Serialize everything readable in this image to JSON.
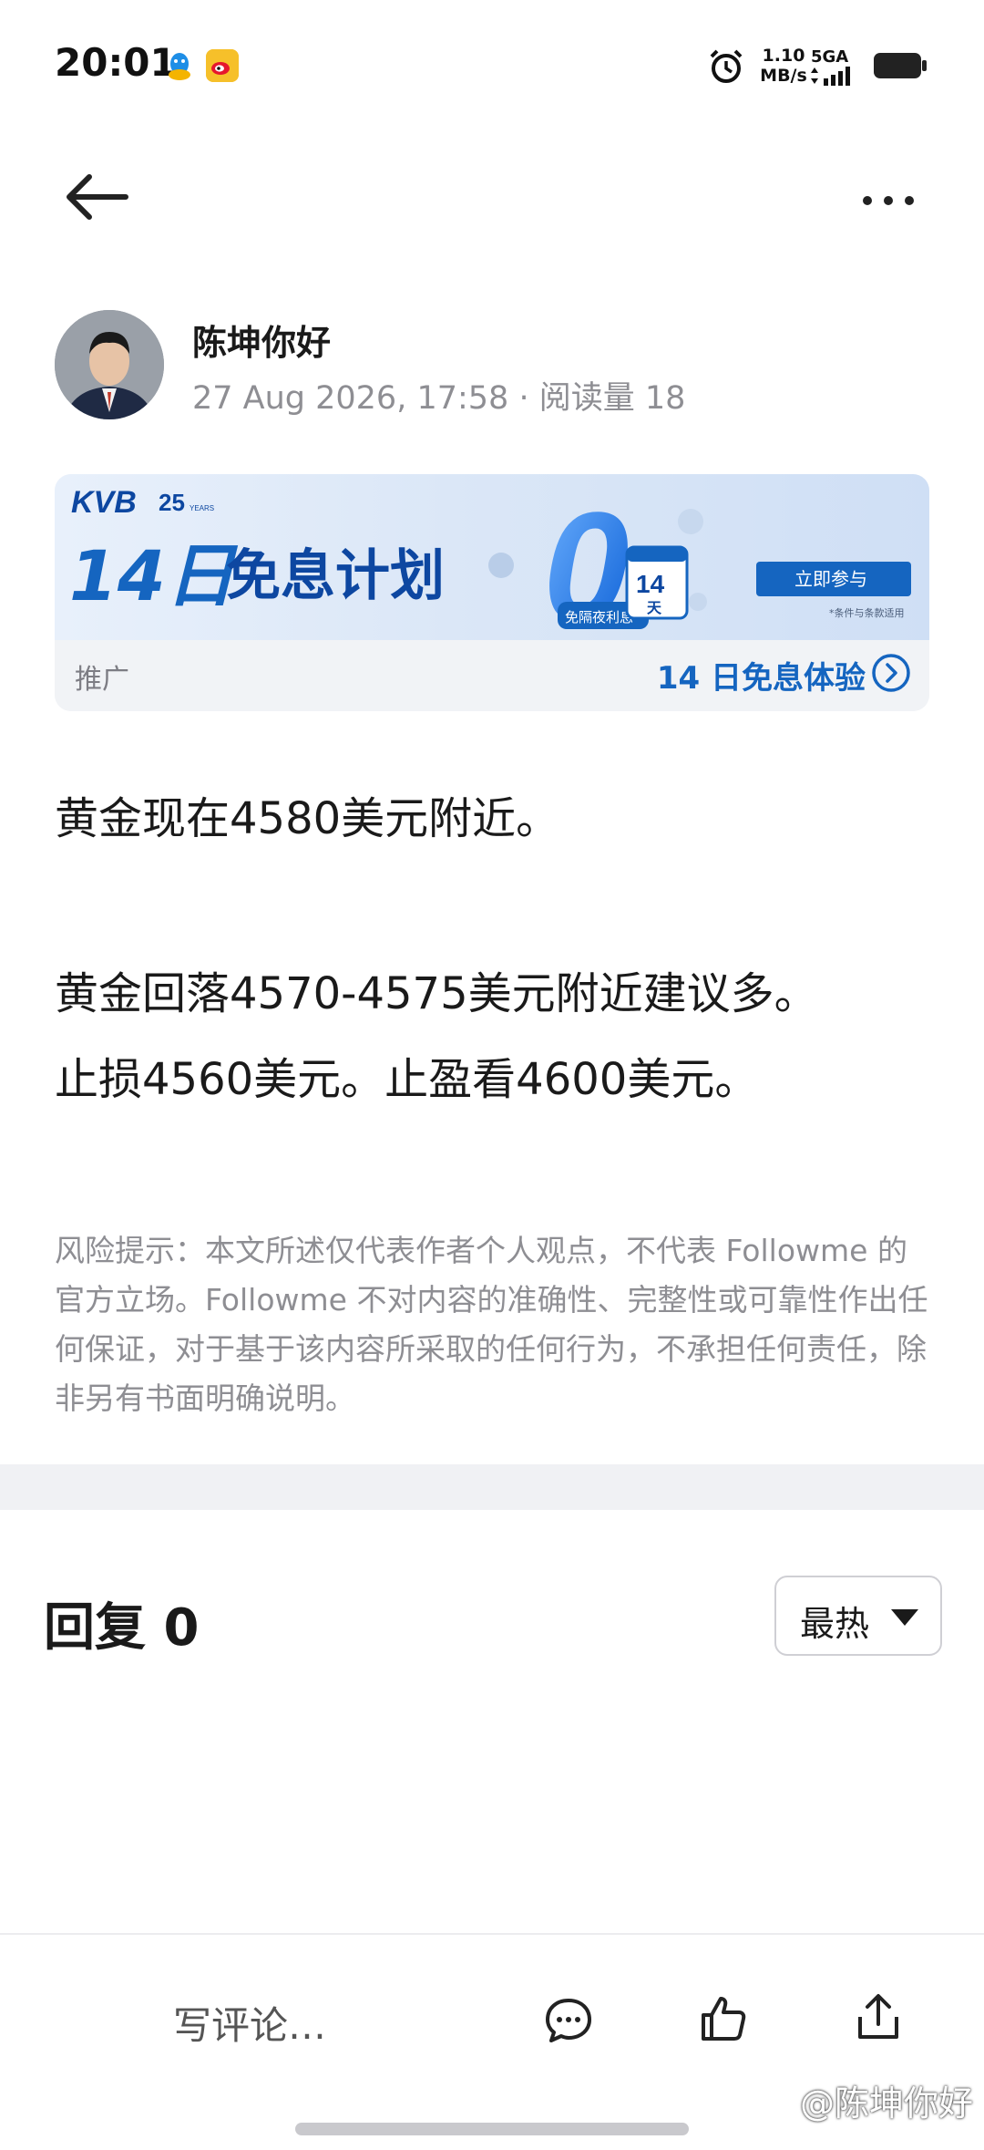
{
  "status_bar": {
    "time": "20:01",
    "net_speed_value": "1.10",
    "net_speed_unit": "MB/s",
    "network_label": "5GA",
    "icons": [
      "qq-icon",
      "weibo-icon",
      "alarm-icon",
      "signal-icon",
      "battery-icon"
    ]
  },
  "nav": {
    "back_icon": "arrow-left-icon",
    "more_icon": "more-horizontal-icon"
  },
  "author": {
    "name": "陈坤你好",
    "meta": "27 Aug 2026, 17:58 · 阅读量 18"
  },
  "ad": {
    "brand": "KVB",
    "anniversary": "25",
    "anniversary_sub": "YEARS",
    "headline_num": "14日",
    "headline_text": "免息计划",
    "zero": "0",
    "badge": "免隔夜利息",
    "cal_num": "14",
    "cal_unit": "天",
    "button": "立即参与",
    "fine_print": "*条件与条款适用",
    "tag": "推广",
    "cta": "14 日免息体验"
  },
  "content": {
    "line1": "黄金现在4580美元附近。",
    "line2": "黄金回落4570-4575美元附近建议多。",
    "line3": "止损4560美元。止盈看4600美元。",
    "disclaimer": "风险提示：本文所述仅代表作者个人观点，不代表 Followme 的官方立场。Followme 不对内容的准确性、完整性或可靠性作出任何保证，对于基于该内容所采取的任何行为，不承担任何责任，除非另有书面明确说明。"
  },
  "replies": {
    "title": "回复 0",
    "sort_label": "最热"
  },
  "bottom_bar": {
    "comment_placeholder": "写评论…",
    "watermark": "@陈坤你好"
  },
  "colors": {
    "accent_blue": "#1565c0",
    "meta_gray": "#8e8e93",
    "divider": "#f0f1f4"
  }
}
